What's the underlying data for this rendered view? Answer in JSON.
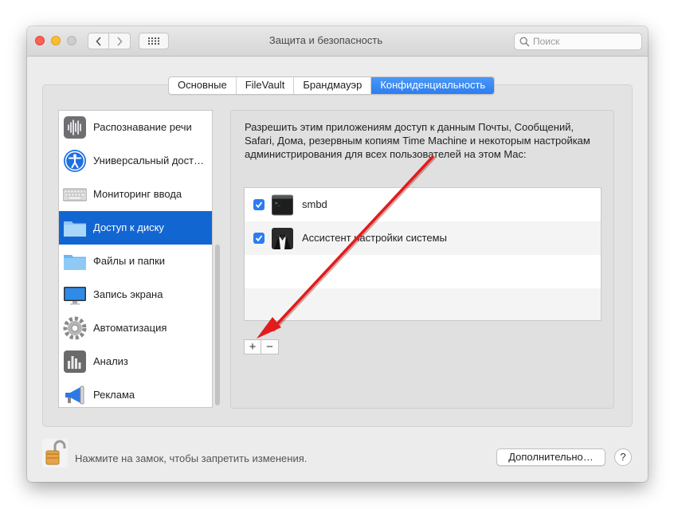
{
  "window": {
    "title": "Защита и безопасность"
  },
  "search": {
    "placeholder": "Поиск"
  },
  "tabs": [
    {
      "label": "Основные"
    },
    {
      "label": "FileVault"
    },
    {
      "label": "Брандмауэр"
    },
    {
      "label": "Конфиденциальность",
      "active": true
    }
  ],
  "sidebar": {
    "items": [
      {
        "label": "Распознавание речи",
        "icon": "waveform-icon"
      },
      {
        "label": "Универсальный дост…",
        "icon": "accessibility-icon"
      },
      {
        "label": "Мониторинг ввода",
        "icon": "keyboard-icon"
      },
      {
        "label": "Доступ к диску",
        "icon": "folder-icon",
        "selected": true
      },
      {
        "label": "Файлы и папки",
        "icon": "folder-icon"
      },
      {
        "label": "Запись экрана",
        "icon": "display-icon"
      },
      {
        "label": "Автоматизация",
        "icon": "gear-icon"
      },
      {
        "label": "Анализ",
        "icon": "bar-chart-icon"
      },
      {
        "label": "Реклама",
        "icon": "megaphone-icon"
      }
    ]
  },
  "main": {
    "description": "Разрешить этим приложениям доступ к данным Почты, Сообщений, Safari, Дома, резервным копиям Time Machine и некоторым настройкам администрирования для всех пользователей на этом Mac:",
    "apps": [
      {
        "label": "smbd",
        "checked": true,
        "icon": "terminal-icon"
      },
      {
        "label": "Ассистент настройки системы",
        "checked": true,
        "icon": "butler-icon"
      }
    ],
    "add_label": "+",
    "remove_label": "−"
  },
  "footer": {
    "lock_text": "Нажмите на замок, чтобы запретить изменения.",
    "advanced_label": "Дополнительно…",
    "help_label": "?"
  },
  "colors": {
    "accent": "#1266d2",
    "annotation_arrow": "#e21b1b"
  }
}
